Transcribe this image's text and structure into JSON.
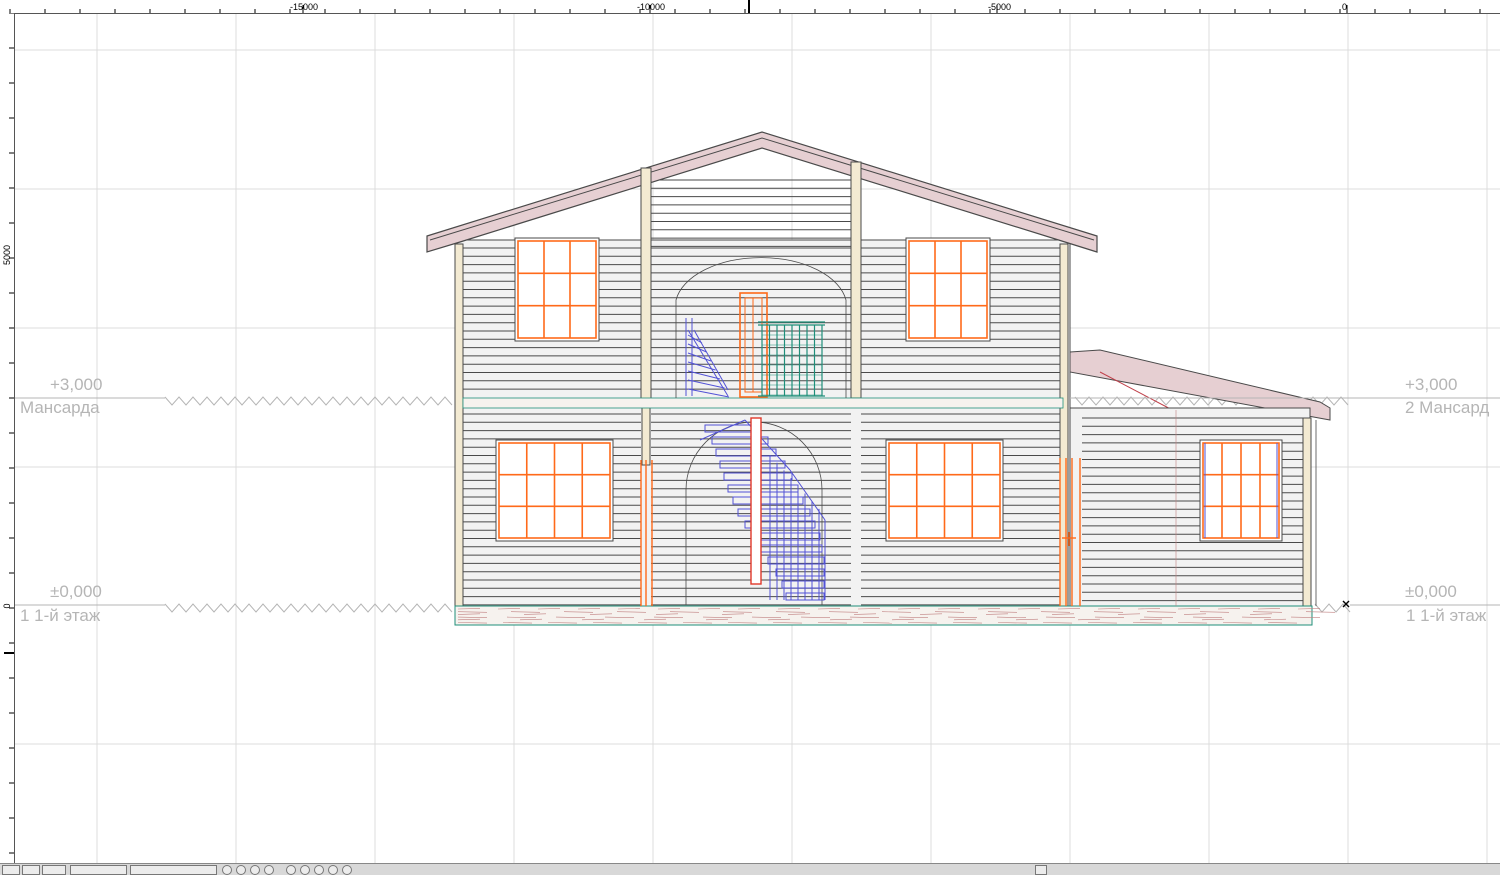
{
  "ruler_top": {
    "labels": [
      "-15000",
      "-10000",
      "-5000",
      "0"
    ]
  },
  "ruler_left": {
    "labels": [
      "5000",
      "0"
    ]
  },
  "levels": {
    "upper_left": {
      "elevation": "+3,000",
      "name": "Мансарда"
    },
    "upper_right": {
      "elevation": "+3,000",
      "name": "2 Мансард"
    },
    "ground_left": {
      "elevation": "±0,000",
      "name": "1 1-й этаж"
    },
    "ground_right": {
      "elevation": "±0,000",
      "name": "1 1-й этаж"
    }
  },
  "colors": {
    "grid": "#dcdcdc",
    "roof": "#e6cfd2",
    "log_fill": "#f2f2f2",
    "log_line": "#4a4a4a",
    "window": "#ff6a1a",
    "stair": "#5252d6",
    "railing": "#1f8f7a",
    "level_text": "#b5b5b5",
    "foundation": "#f6f2ee"
  },
  "icons": [
    "close-marker-icon"
  ]
}
